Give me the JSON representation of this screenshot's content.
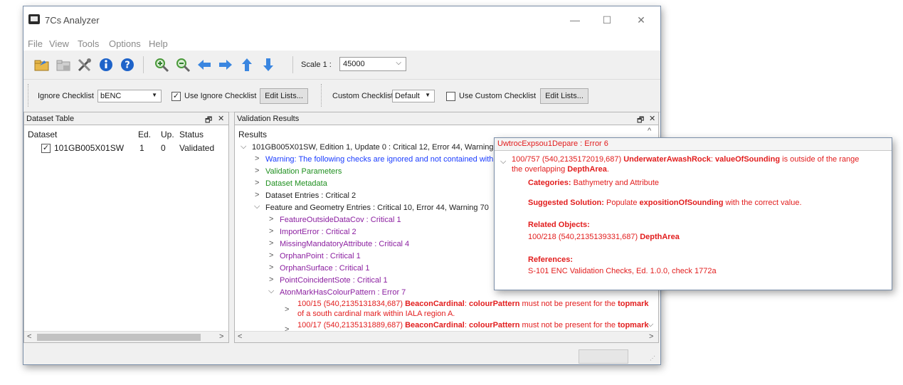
{
  "window": {
    "title": "7Cs Analyzer",
    "controls": {
      "minimize": "—",
      "maximize": "☐",
      "close": "✕"
    }
  },
  "menu": [
    "File",
    "View",
    "Tools",
    "Options",
    "Help"
  ],
  "toolbar": {
    "icons": [
      "open-folder-icon",
      "close-file-icon",
      "tools-icon",
      "info-icon",
      "help-icon",
      "zoom-in-icon",
      "zoom-out-icon",
      "arrow-left-icon",
      "arrow-right-icon",
      "arrow-up-icon",
      "arrow-down-icon"
    ],
    "scale_label": "Scale 1 :",
    "scale_value": "45000"
  },
  "checklists": {
    "ignore_label": "Ignore Checklist",
    "ignore_value": "bENC",
    "use_ignore_label": "Use Ignore Checklist",
    "use_ignore_checked": true,
    "edit_lists_1": "Edit Lists...",
    "custom_label": "Custom Checklist",
    "custom_value": "Default",
    "use_custom_label": "Use Custom Checklist",
    "use_custom_checked": false,
    "edit_lists_2": "Edit Lists..."
  },
  "dataset_table": {
    "title": "Dataset Table",
    "float_icon": "🗗",
    "close_icon": "✕",
    "columns": [
      "Dataset",
      "Ed.",
      "Up.",
      "Status"
    ],
    "rows": [
      {
        "dataset": "101GB005X01SW",
        "ed": "1",
        "up": "0",
        "status": "Validated",
        "checked": true
      }
    ]
  },
  "validation_results": {
    "title": "Validation Results",
    "float_icon": "🗗",
    "close_icon": "✕",
    "header": "Results",
    "root": "101GB005X01SW, Edition 1, Update 0 : Critical 12, Error 44, Warning 70",
    "warning": "Warning: The following checks are ignored and not contained within",
    "validation_parameters": "Validation Parameters",
    "dataset_metadata": "Dataset Metadata",
    "dataset_entries": "Dataset Entries : Critical 2",
    "feature_geometry": "Feature and Geometry Entries : Critical 10, Error 44, Warning 70",
    "checks": [
      "FeatureOutsideDataCov : Critical 1",
      "ImportError : Critical 2",
      "MissingMandatoryAttribute : Critical 4",
      "OrphanPoint : Critical 1",
      "OrphanSurface : Critical 1",
      "PointCoincidentSote : Critical 1",
      "AtonMarkHasColourPattern : Error 7"
    ],
    "items": [
      {
        "id": "100/15 (540,2135131834,687)",
        "feature": "BeaconCardinal",
        "attr": "colourPattern",
        "text": "must not be present for the",
        "topmark": "topmark",
        "line2": "of a south cardinal mark within IALA region A."
      },
      {
        "id": "100/17 (540,2135131889,687)",
        "feature": "BeaconCardinal",
        "attr": "colourPattern",
        "text": "must not be present for the",
        "topmark": "topmark"
      }
    ]
  },
  "popup": {
    "header": "UwtrocExpsou1Depare : Error 6",
    "id": "100/757 (540,2135172019,687)",
    "feature": "UnderwaterAwashRock",
    "attr": "valueOfSounding",
    "text1": "is outside of the range",
    "text2": "the overlapping",
    "area": "DepthArea",
    "categories_label": "Categories:",
    "categories_value": "Bathymetry and Attribute",
    "solution_label": "Suggested Solution:",
    "solution_prefix": "Populate",
    "solution_attr": "expositionOfSounding",
    "solution_suffix": "with the correct value.",
    "related_label": "Related Objects:",
    "related_id": "100/218 (540,2135139331,687)",
    "related_name": "DepthArea",
    "references_label": "References:",
    "references_value": "S-101 ENC Validation Checks, Ed. 1.0.0, check 1772a"
  },
  "colors": {
    "accent_red": "#e21d1d",
    "purple": "#8b1fa0",
    "green": "#1f8f1f",
    "blue": "#1a3cff"
  }
}
